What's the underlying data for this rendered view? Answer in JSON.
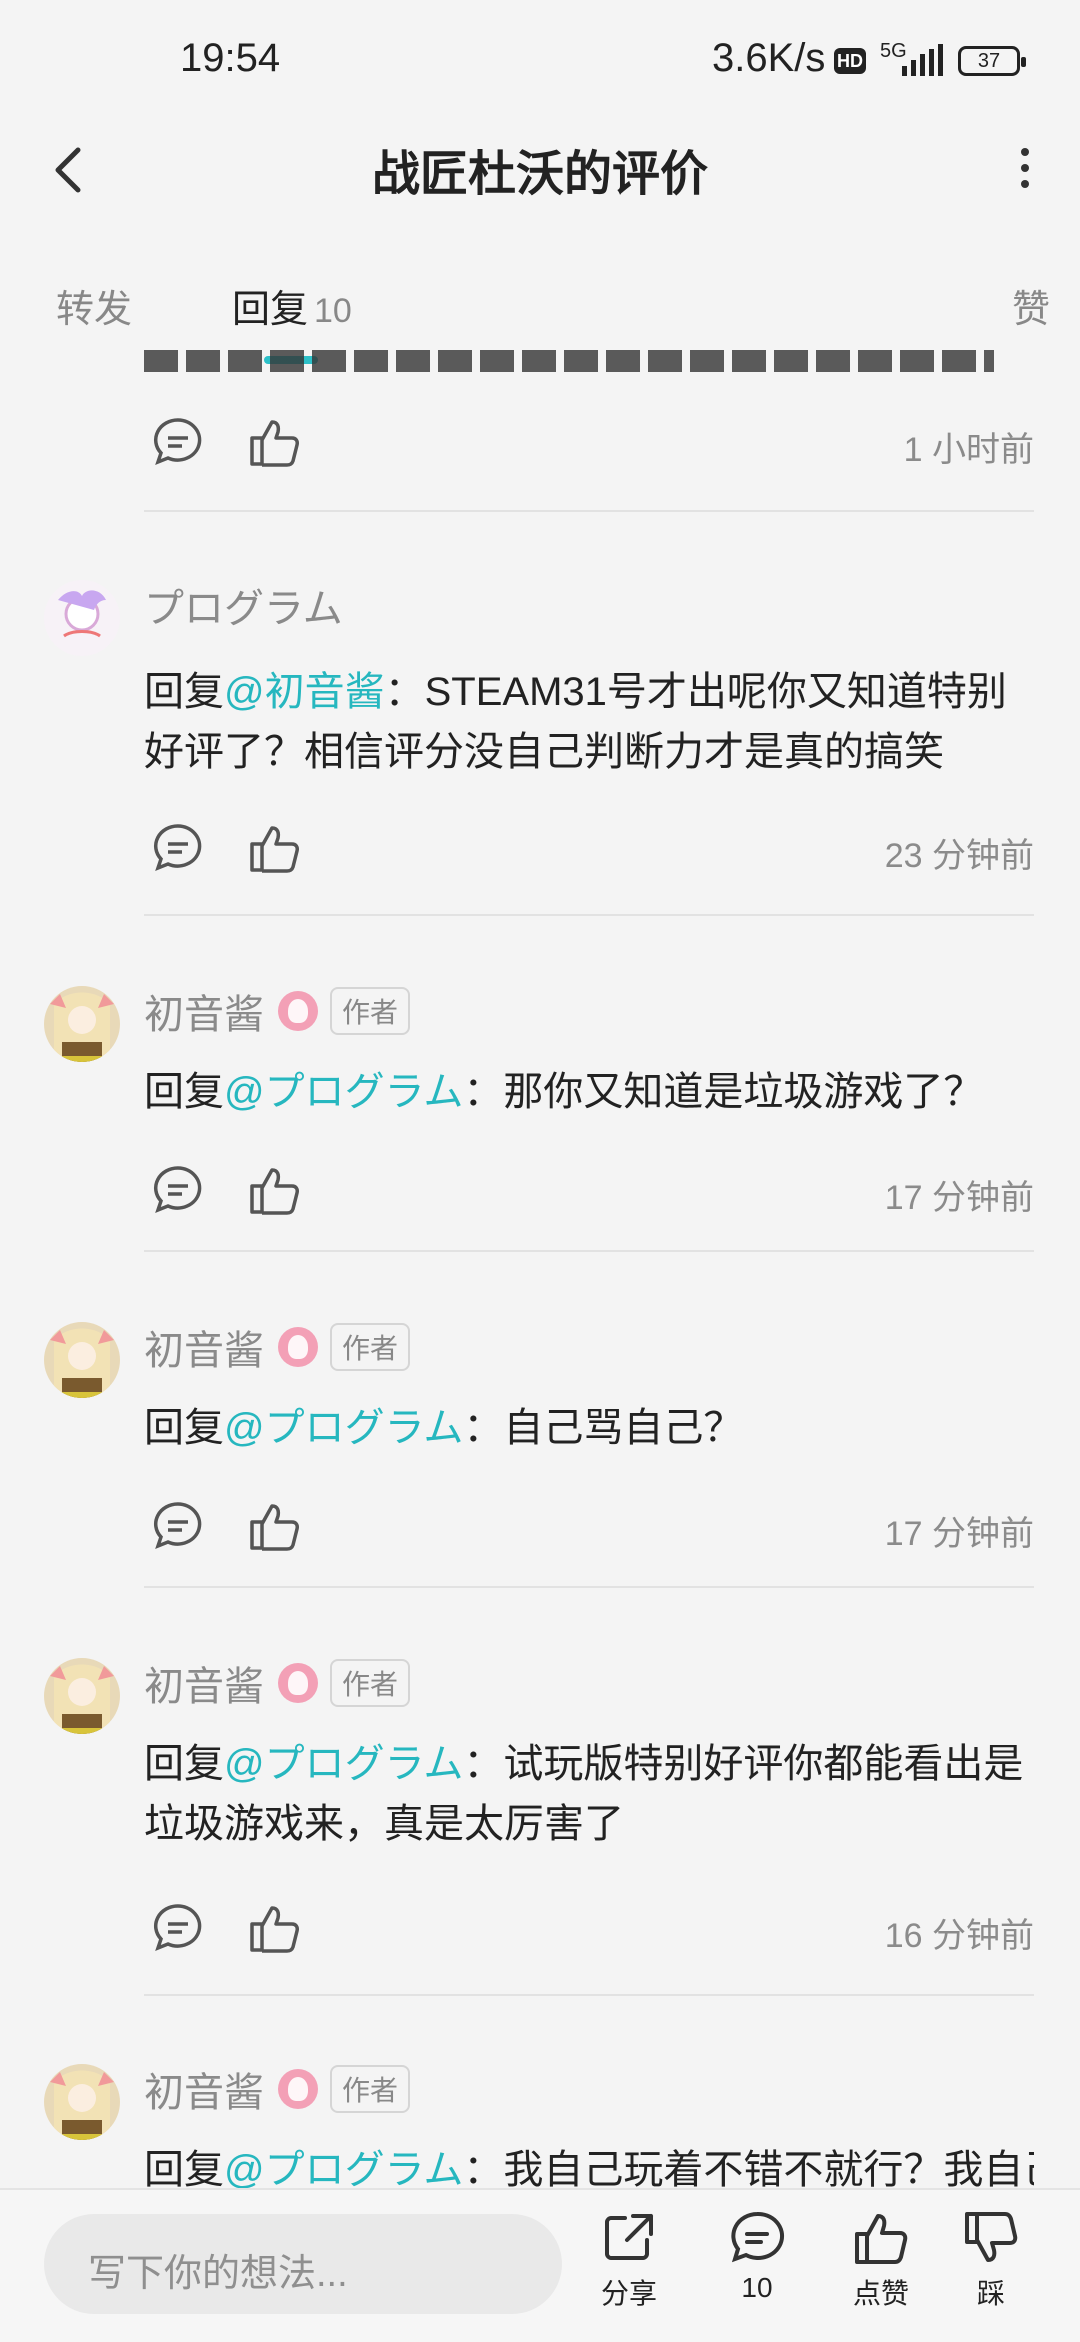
{
  "status_bar": {
    "time": "19:54",
    "speed": "3.6K/s",
    "hd": "HD",
    "signal": "5G",
    "battery": "37"
  },
  "header": {
    "title": "战匠杜沃的评价"
  },
  "tabs": {
    "forward": "转发",
    "reply": "回复",
    "reply_count": "10",
    "like": "赞"
  },
  "top_item": {
    "time": "1 小时前"
  },
  "comments": [
    {
      "name": "プログラム",
      "reply_prefix": "回复",
      "mention": "@初音酱",
      "text": "：STEAM31号才出呢你又知道特别好评了？相信评分没自己判断力才是真的搞笑",
      "time": "23 分钟前",
      "author": false
    },
    {
      "name": "初音酱",
      "author_badge": "作者",
      "reply_prefix": "回复",
      "mention": "@プログラム",
      "text": "：那你又知道是垃圾游戏了？",
      "time": "17 分钟前"
    },
    {
      "name": "初音酱",
      "author_badge": "作者",
      "reply_prefix": "回复",
      "mention": "@プログラム",
      "text": "：自己骂自己？",
      "time": "17 分钟前"
    },
    {
      "name": "初音酱",
      "author_badge": "作者",
      "reply_prefix": "回复",
      "mention": "@プログラム",
      "text": "：试玩版特别好评你都能看出是垃圾游戏来，真是太厉害了",
      "time": "16 分钟前"
    },
    {
      "name": "初音酱",
      "author_badge": "作者",
      "reply_prefix": "回复",
      "mention": "@プログラム",
      "text": "：我自己玩着不错不就行？我自己"
    }
  ],
  "bottom_bar": {
    "placeholder": "写下你的想法...",
    "share": "分享",
    "comment_count": "10",
    "like": "点赞",
    "dislike": "踩"
  },
  "colors": {
    "accent": "#2dc1c9",
    "mention": "#26b7bf",
    "background": "#f4f4f4"
  }
}
